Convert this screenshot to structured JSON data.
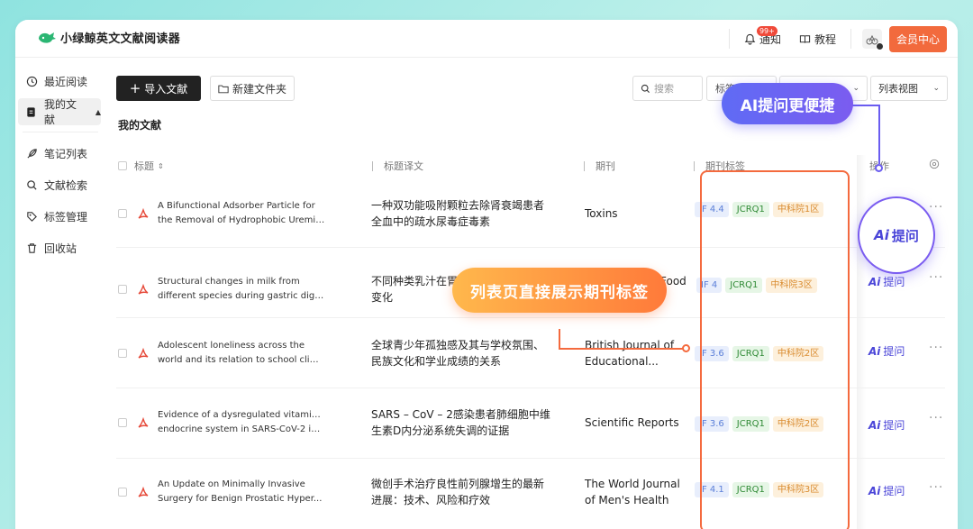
{
  "app": {
    "name": "小绿鲸英文文献阅读器"
  },
  "header": {
    "notify_label": "通知",
    "notify_badge": "99+",
    "tutorial_label": "教程",
    "vip_label": "会员中心"
  },
  "sidebar": {
    "items": [
      {
        "label": "最近阅读",
        "icon": "clock-icon"
      },
      {
        "label": "我的文献",
        "icon": "document-icon"
      },
      {
        "label": "笔记列表",
        "icon": "feather-icon"
      },
      {
        "label": "文献检索",
        "icon": "search-icon"
      },
      {
        "label": "标签管理",
        "icon": "tag-icon"
      },
      {
        "label": "回收站",
        "icon": "trash-icon"
      }
    ]
  },
  "toolbar": {
    "import_label": "导入文献",
    "new_folder_label": "新建文件夹",
    "search_placeholder": "搜索",
    "tag_filter": "标签",
    "view_select": "列表视图"
  },
  "section_title": "我的文献",
  "table": {
    "headers": {
      "title": "标题",
      "title_cn": "标题译文",
      "journal": "期刊",
      "journal_tags": "期刊标签",
      "actions": "操作"
    },
    "rows": [
      {
        "title_en_1": "A Bifunctional Adsorber Particle for",
        "title_en_2": "the Removal of Hydrophobic Uremic...",
        "title_cn": "一种双功能吸附颗粒去除肾衰竭患者全血中的疏水尿毒症毒素",
        "journal": "Toxins",
        "if": "IF 4.4",
        "jcr": "JCRQ1",
        "cas": "中科院1区",
        "ask": "提问"
      },
      {
        "title_en_1": "Structural changes in milk from",
        "title_en_2": "different species during gastric dige...",
        "title_cn": "不同种类乳汁在胃消化过程中的结构变化",
        "journal": "Food Chemistry",
        "if": "IF 4",
        "jcr": "JCRQ1",
        "cas": "中科院3区",
        "ask": "提问"
      },
      {
        "title_en_1": "Adolescent loneliness across the",
        "title_en_2": "world and its relation to school clim...",
        "title_cn": "全球青少年孤独感及其与学校氛围、民族文化和学业成绩的关系",
        "journal": "British Journal of Educational...",
        "if": "IF 3.6",
        "jcr": "JCRQ1",
        "cas": "中科院2区",
        "ask": "提问"
      },
      {
        "title_en_1": "Evidence of a dysregulated vitamin D",
        "title_en_2": "endocrine system in SARS-CoV-2 in...",
        "title_cn": "SARS – CoV – 2感染患者肺细胞中维生素D内分泌系统失调的证据",
        "journal": "Scientific Reports",
        "if": "IF 3.6",
        "jcr": "JCRQ1",
        "cas": "中科院2区",
        "ask": "提问"
      },
      {
        "title_en_1": "An Update on Minimally Invasive",
        "title_en_2": "Surgery for Benign Prostatic Hyper...",
        "title_cn": "微创手术治疗良性前列腺增生的最新进展：技术、风险和疗效",
        "journal": "The World Journal of Men's Health",
        "if": "IF 4.1",
        "jcr": "JCRQ1",
        "cas": "中科院3区",
        "ask": "提问"
      }
    ]
  },
  "callouts": {
    "ai": "AI提问更便捷",
    "tags": "列表页直接展示期刊标签",
    "big_ask": "提问"
  },
  "colors": {
    "accent_orange": "#f26a3d",
    "ai_purple": "#4a45d8"
  }
}
